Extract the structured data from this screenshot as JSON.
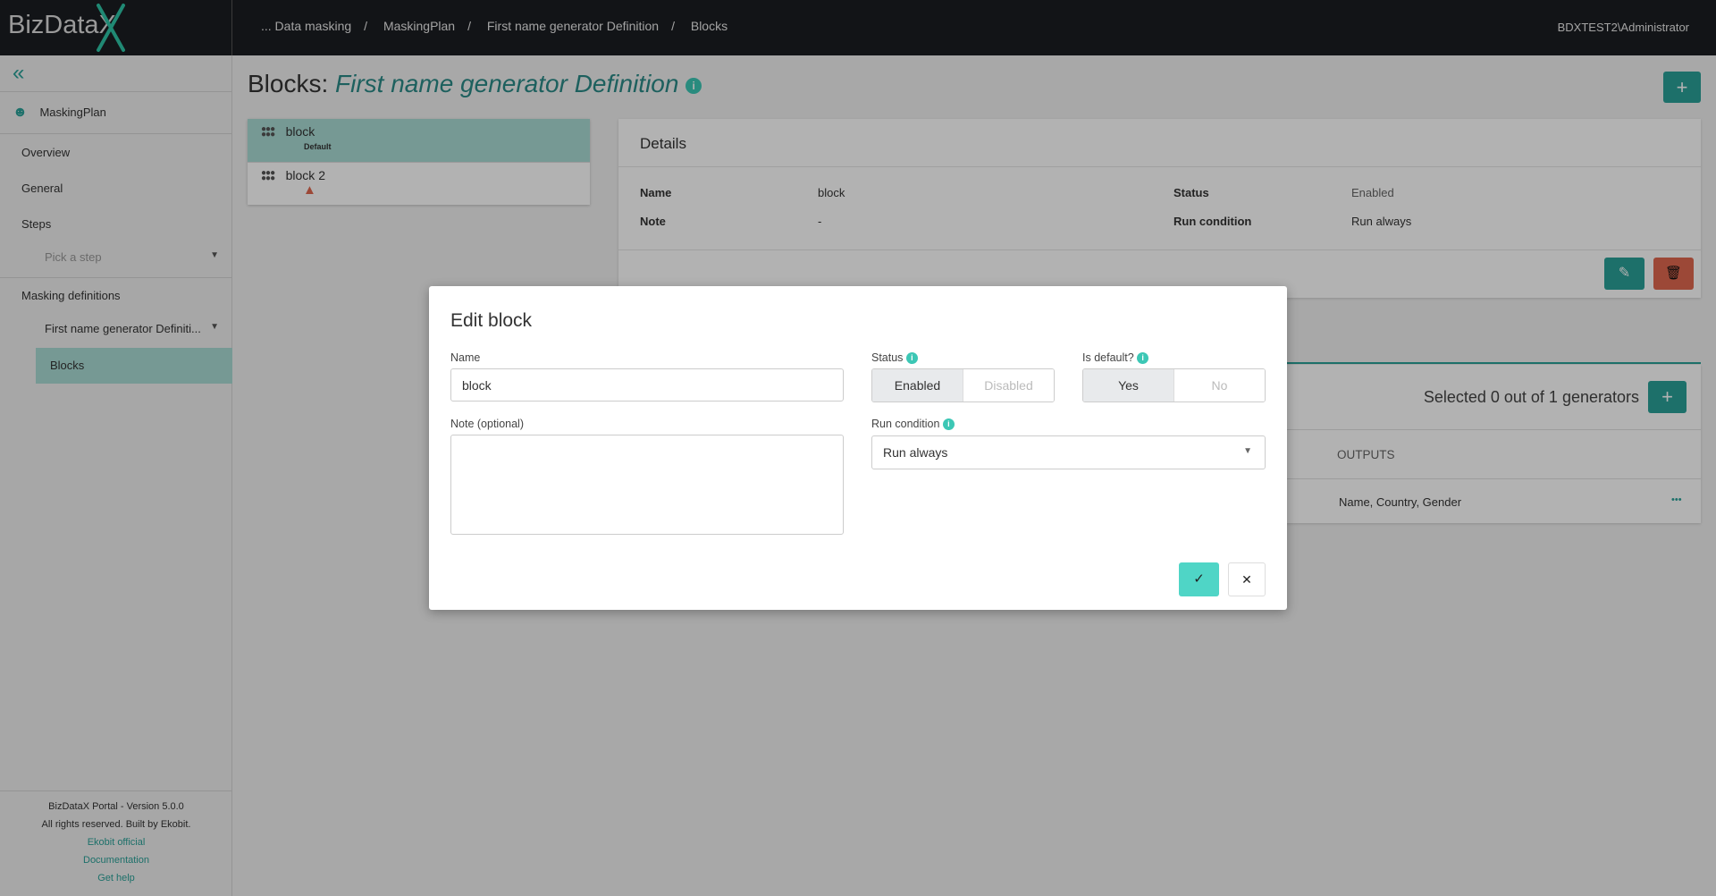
{
  "header": {
    "logo": "BizDataX",
    "breadcrumbs": [
      "... Data masking",
      "MaskingPlan",
      "First name generator Definition",
      "Blocks"
    ],
    "separator": "/",
    "user": "BDXTEST2\\Administrator"
  },
  "sidebar": {
    "collapse_icon": "double-chevron-left",
    "plan": "MaskingPlan",
    "items": [
      "Overview",
      "General",
      "Steps"
    ],
    "step_picker": "Pick a step",
    "masking_definitions": "Masking definitions",
    "definition_picker": "First name generator Definiti...",
    "active": "Blocks",
    "footer": {
      "version": "BizDataX Portal - Version 5.0.0",
      "rights": "All rights reserved. Built by Ekobit.",
      "links": [
        "Ekobit official",
        "Documentation",
        "Get help"
      ]
    }
  },
  "page": {
    "title_prefix": "Blocks:",
    "title_name": "First name generator Definition",
    "add": "+"
  },
  "blocks": [
    {
      "name": "block",
      "badge": "Default",
      "selected": true
    },
    {
      "name": "block 2",
      "warning": true
    }
  ],
  "details": {
    "header": "Details",
    "name_label": "Name",
    "name": "block",
    "note_label": "Note",
    "note": "-",
    "status_label": "Status",
    "status": "Enabled",
    "run_label": "Run condition",
    "run": "Run always"
  },
  "generators": {
    "summary": "Selected 0 out of 1 generators",
    "add": "+",
    "column": "OUTPUTS",
    "row": "Name, Country, Gender",
    "more": "•••"
  },
  "modal": {
    "title": "Edit block",
    "name_label": "Name",
    "name_value": "block",
    "note_label": "Note (optional)",
    "note_value": "",
    "status_label": "Status",
    "status_options": [
      "Enabled",
      "Disabled"
    ],
    "status_selected": "Enabled",
    "default_label": "Is default?",
    "default_options": [
      "Yes",
      "No"
    ],
    "default_selected": "Yes",
    "run_label": "Run condition",
    "run_value": "Run always",
    "confirm": "✓",
    "cancel": "✕"
  },
  "colors": {
    "accent": "#2aa198",
    "modal_confirm": "#4fd5c6",
    "delete": "#e0684f",
    "topbar": "#1b1d21"
  }
}
